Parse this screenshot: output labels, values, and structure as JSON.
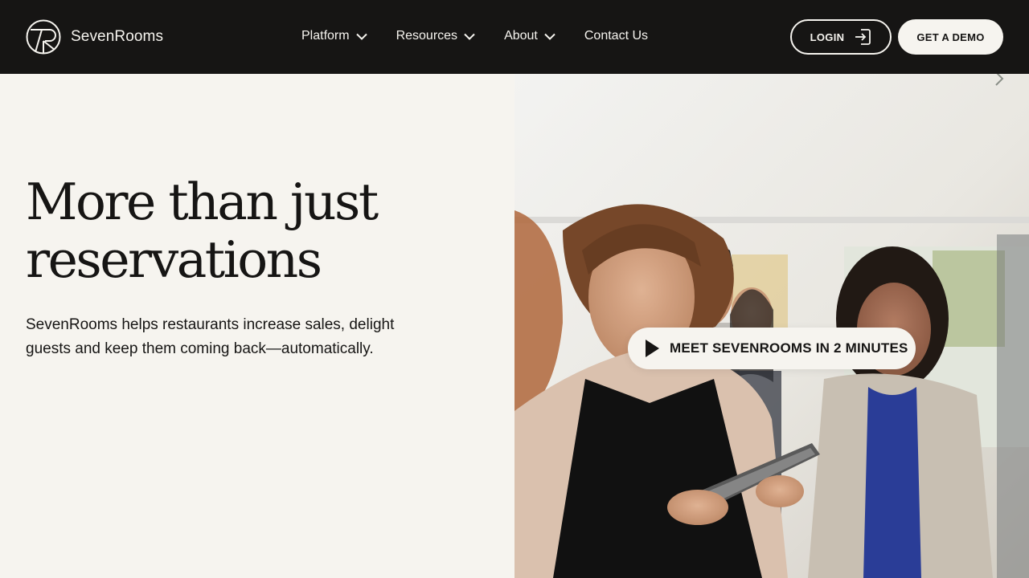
{
  "brand": {
    "name": "SevenRooms"
  },
  "nav": {
    "items": [
      {
        "label": "Platform",
        "has_dropdown": true
      },
      {
        "label": "Resources",
        "has_dropdown": true
      },
      {
        "label": "About",
        "has_dropdown": true
      },
      {
        "label": "Contact Us",
        "has_dropdown": false
      }
    ]
  },
  "header": {
    "login_label": "LOGIN",
    "demo_label": "GET A DEMO"
  },
  "hero": {
    "title": "More than just reservations",
    "subtitle": "SevenRooms helps restaurants increase sales, delight guests and keep them coming back—automatically.",
    "video_button_label": "MEET SEVENROOMS IN 2 MINUTES"
  },
  "colors": {
    "header_bg": "#161514",
    "page_bg": "#f6f4ef",
    "text": "#161514",
    "light_text": "#f6f4ef"
  },
  "icons": {
    "logo": "sevenrooms-logo-icon",
    "dropdown": "chevron-down-icon",
    "login": "login-arrow-icon",
    "play": "play-icon"
  }
}
